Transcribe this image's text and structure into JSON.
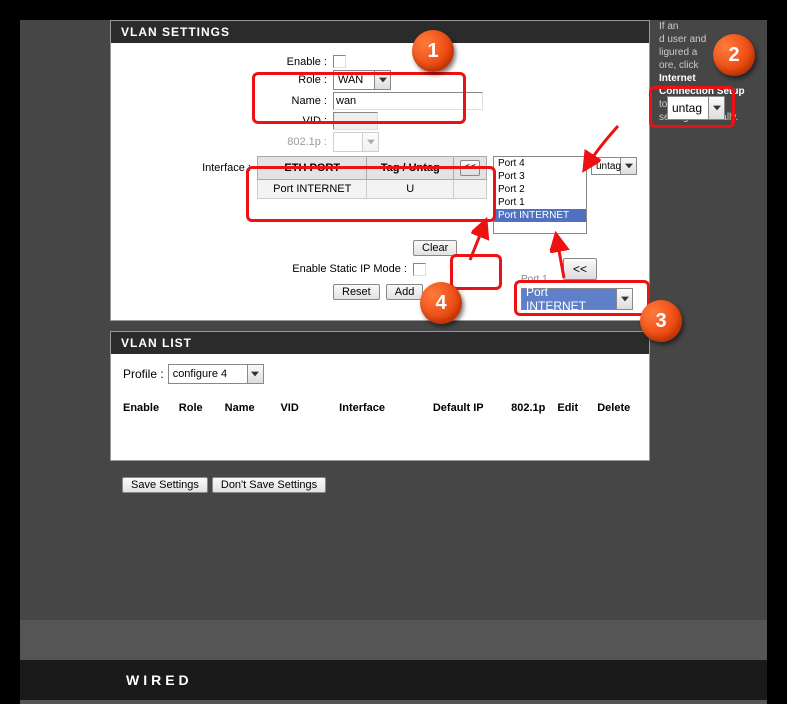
{
  "settings_header": "VLAN SETTINGS",
  "enable_label": "Enable :",
  "role_label": "Role :",
  "role_value": "WAN",
  "name_label": "Name :",
  "name_value": "wan",
  "vid_label": "VID :",
  "vid_value": "",
  "p8021_label": "802.1p :",
  "interface_label": "Interface :",
  "port_table": {
    "col1": "ETH PORT",
    "col2": "Tag / Untag",
    "row_port": "Port INTERNET",
    "row_tag": "U"
  },
  "clear_btn": "Clear",
  "enable_static_label": "Enable Static IP Mode :",
  "reset_btn": "Reset",
  "add_btn": "Add",
  "move_btn": "<<",
  "untag_small": "untag",
  "untag_large": "untag",
  "port_list": [
    "Port 4",
    "Port 3",
    "Port 2",
    "Port 1",
    "Port INTERNET"
  ],
  "port_list_selected": "Port INTERNET",
  "port_inet_big": "Port INTERNET",
  "port1_ghost": "Port 1",
  "list_header": "VLAN LIST",
  "profile_label": "Profile :",
  "profile_value": "configure 4",
  "cols": {
    "enable": "Enable",
    "role": "Role",
    "name": "Name",
    "vid": "VID",
    "iface": "Interface",
    "defip": "Default IP",
    "p8021": "802.1p",
    "edit": "Edit",
    "delete": "Delete"
  },
  "save_btn": "Save Settings",
  "dont_save_btn": "Don't Save Settings",
  "footer": "WIRED",
  "hints": {
    "l1": "If an",
    "l2": "d user and",
    "l3": "ligured a",
    "l4": "ore, click",
    "l5": "Internet",
    "l6": "Connection Setup",
    "l7": "to input all the",
    "l8": "settings manually."
  },
  "badges": {
    "b1": "1",
    "b2": "2",
    "b3": "3",
    "b4": "4"
  }
}
